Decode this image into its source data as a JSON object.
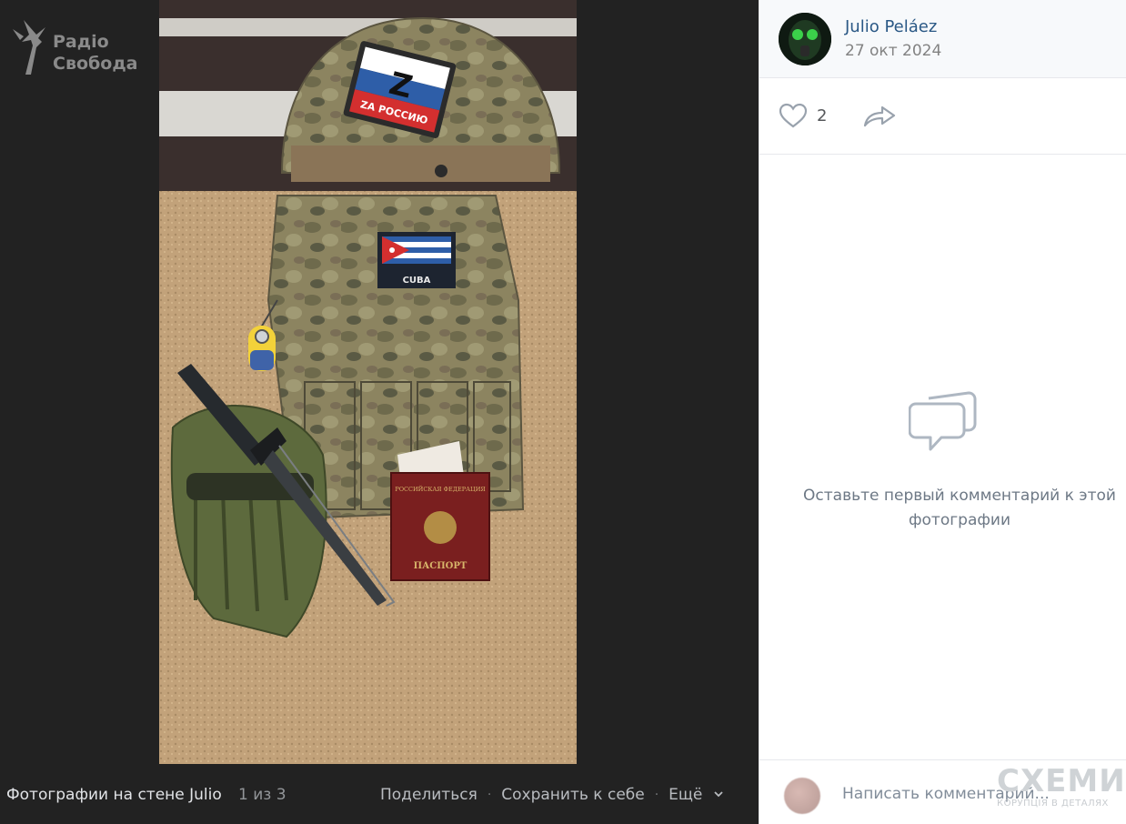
{
  "watermark": {
    "line1": "Радіо",
    "line2": "Свобода"
  },
  "photo": {
    "helmet_patch_letter": "Z",
    "helmet_patch_text": "ZA РОССИЮ",
    "vest_patch_text": "CUBA",
    "passport_header": "РОССИЙСКАЯ ФЕДЕРАЦИЯ",
    "passport_title": "ПАСПОРТ"
  },
  "bottom_bar": {
    "album": "Фотографии на стене Julio",
    "counter": "1 из 3",
    "share": "Поделиться",
    "save": "Сохранить к себе",
    "more": "Ещё"
  },
  "author": {
    "name": "Julio Peláez",
    "date": "27 окт 2024"
  },
  "reactions": {
    "likes": "2"
  },
  "comments": {
    "empty_text": "Оставьте первый комментарий к этой фотографии",
    "placeholder": "Написать комментарий..."
  },
  "overlay_logo": {
    "title": "СХЕМИ",
    "subtitle": "КОРУПЦІЯ В ДЕТАЛЯХ"
  },
  "colors": {
    "viewer_bg": "#222222",
    "link": "#2a5885",
    "muted": "#828282",
    "icon": "#99a2ad"
  }
}
